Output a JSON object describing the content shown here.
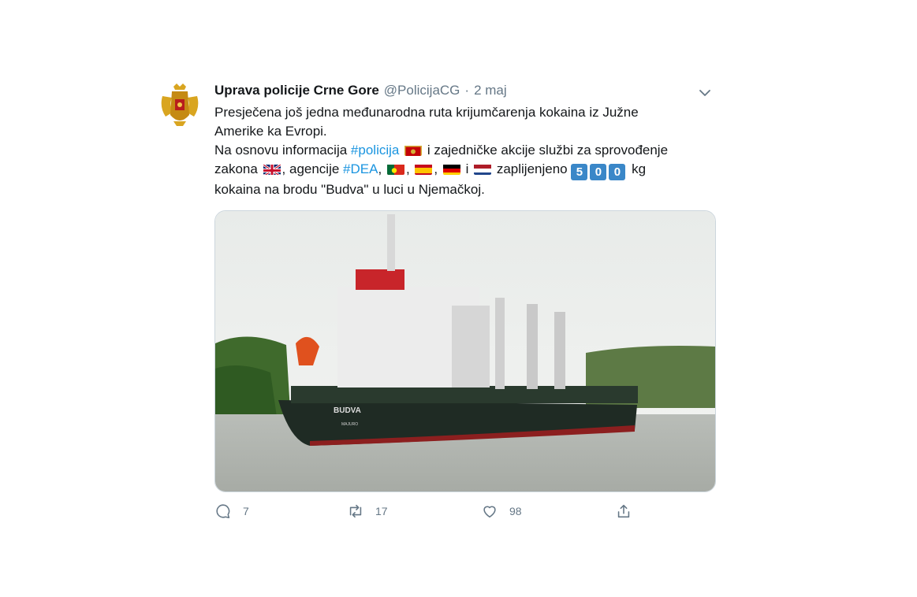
{
  "tweet": {
    "author_name": "Uprava policije Crne Gore",
    "author_handle": "@PolicijaCG",
    "separator": "·",
    "date": "2 maj",
    "text": {
      "line1": "Presječena još jedna međunarodna ruta krijumčarenja kokaina iz Južne",
      "line2": "Amerike ka Evropi.",
      "line3_a": "Na osnovu informacija ",
      "hashtag_policija": "#policija",
      "line3_b": " i zajedničke akcije službi za sprovođenje",
      "line4_a": "zakona ",
      "line4_b": ", agencije ",
      "hashtag_dea": "#DEA",
      "comma": ",",
      "conj_i": " i ",
      "line4_c": " zaplijenjeno ",
      "keycap_1": "5",
      "keycap_2": "0",
      "keycap_3": "0",
      "line4_d": " kg",
      "line5": "kokaina na brodu \"Budva\" u luci u Njemačkoj."
    },
    "image": {
      "ship_name": "BUDVA",
      "port_of_registry": "MAJURO"
    },
    "actions": {
      "reply_count": "7",
      "retweet_count": "17",
      "like_count": "98"
    }
  },
  "icons": [
    "crest-icon",
    "chevron-down-icon",
    "flag-montenegro-icon",
    "flag-uk-icon",
    "flag-portugal-icon",
    "flag-spain-icon",
    "flag-germany-icon",
    "flag-netherlands-icon",
    "reply-icon",
    "retweet-icon",
    "like-icon",
    "share-icon"
  ],
  "colors": {
    "link": "#1b95e0",
    "muted": "#657786",
    "text": "#14171a",
    "keycap": "#3a87c8"
  }
}
